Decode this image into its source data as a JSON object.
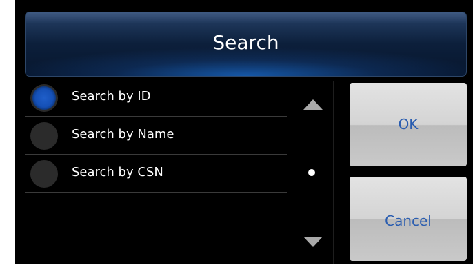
{
  "dialog": {
    "title": "Search"
  },
  "options": [
    {
      "label": "Search by ID",
      "selected": true
    },
    {
      "label": "Search by Name",
      "selected": false
    },
    {
      "label": "Search by CSN",
      "selected": false
    },
    {
      "label": "",
      "selected": false
    }
  ],
  "scrollbar": {
    "up_icon": "triangle-up",
    "down_icon": "triangle-down",
    "position_indicator": "dot"
  },
  "buttons": {
    "ok_label": "OK",
    "cancel_label": "Cancel"
  },
  "colors": {
    "background": "#000000",
    "title_bar": "#0c1f3b",
    "radio_selected": "#1550b6",
    "button_text": "#2a5db0",
    "button_bg": "#d4d4d4"
  }
}
